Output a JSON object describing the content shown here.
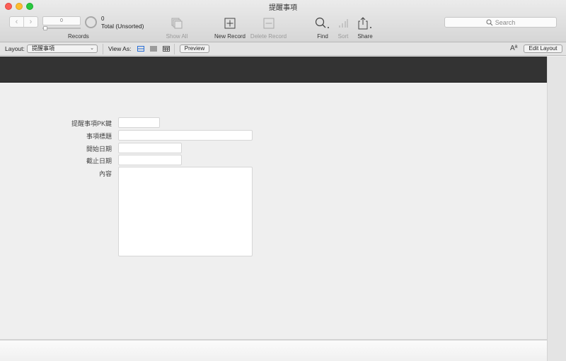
{
  "window": {
    "title": "提醒事項"
  },
  "toolbar": {
    "nav_prev": "‹",
    "nav_next": "›",
    "record_number": "0",
    "records_label": "Records",
    "found_count": "0",
    "total_label": "Total (Unsorted)",
    "show_all": "Show All",
    "new_record": "New Record",
    "delete_record": "Delete Record",
    "find": "Find",
    "sort": "Sort",
    "share": "Share",
    "search_placeholder": "Search"
  },
  "layout_bar": {
    "layout_label": "Layout:",
    "layout_value": "提醒事項",
    "view_as_label": "View As:",
    "preview": "Preview",
    "edit_layout": "Edit Layout",
    "text_format_icon": "Aª"
  },
  "form": {
    "fields": [
      {
        "label": "提醒事項PK鍵",
        "value": ""
      },
      {
        "label": "事項標題",
        "value": ""
      },
      {
        "label": "開始日期",
        "value": ""
      },
      {
        "label": "截止日期",
        "value": ""
      },
      {
        "label": "內容",
        "value": ""
      }
    ]
  }
}
